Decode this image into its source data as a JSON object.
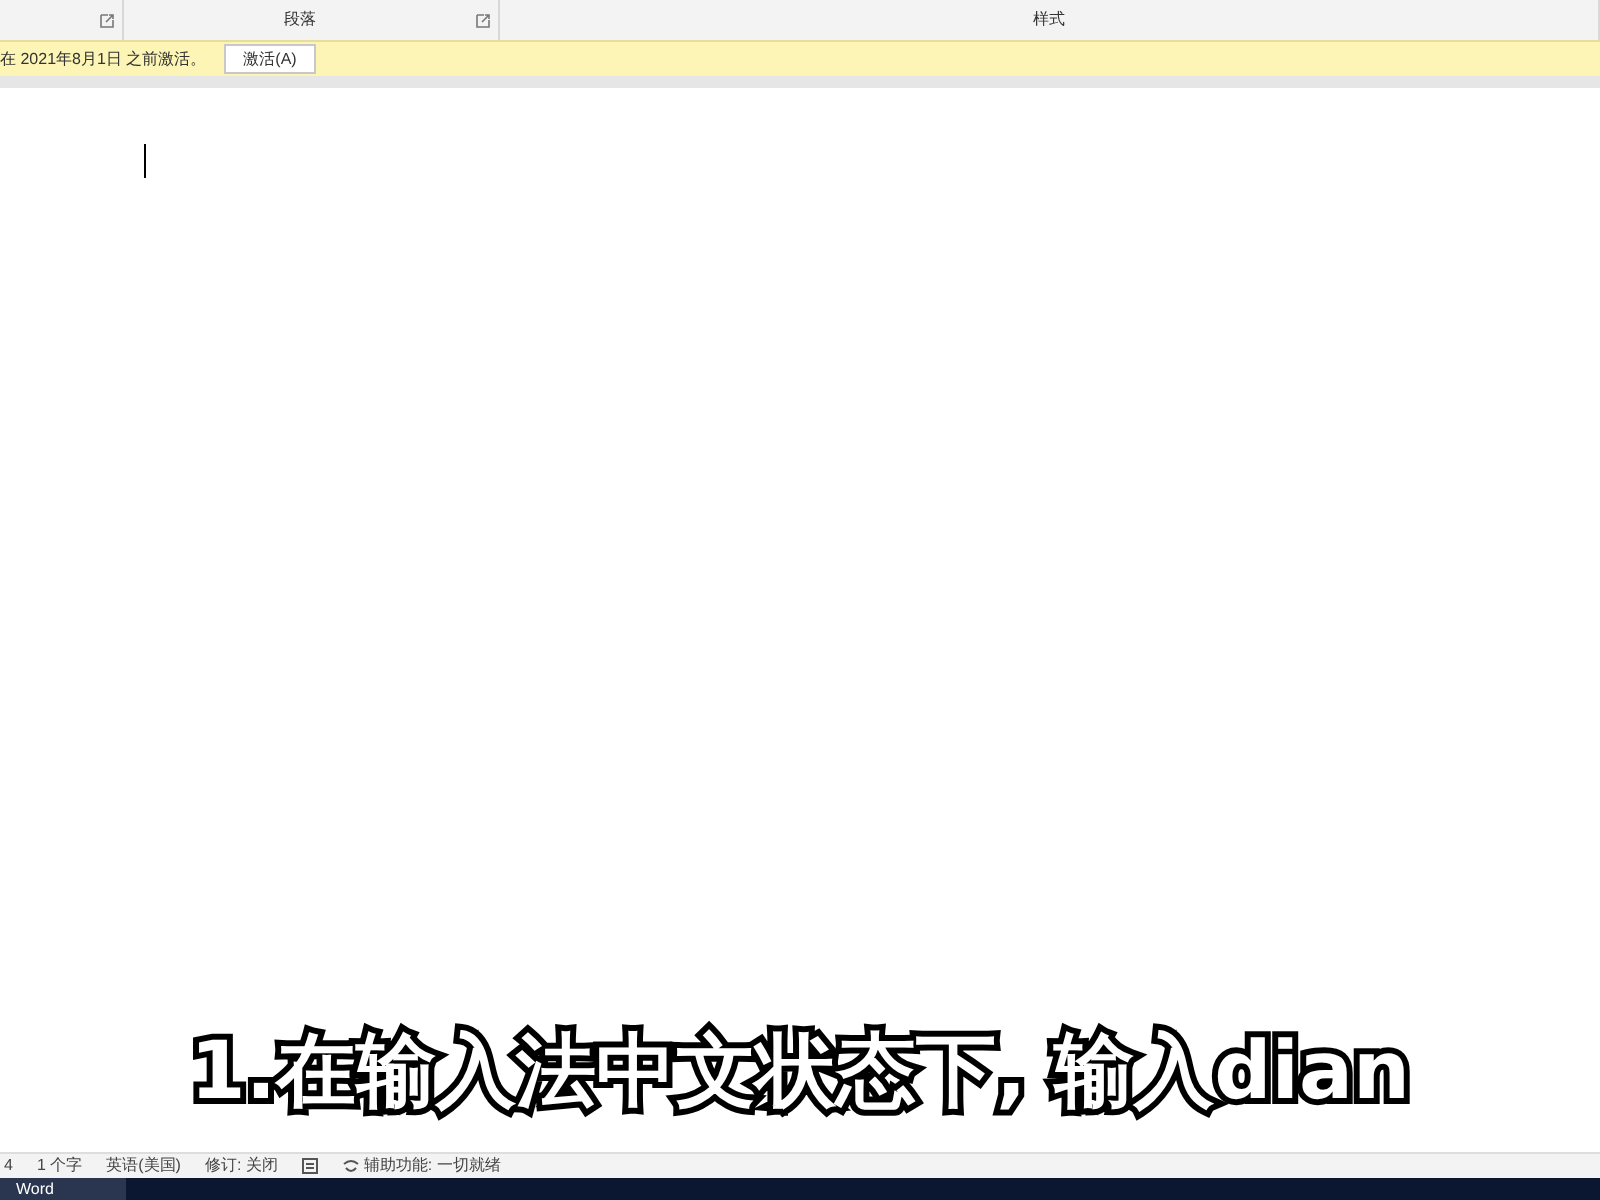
{
  "ribbon": {
    "groups": [
      {
        "launcher": true
      },
      {
        "label": "段落",
        "launcher": true
      },
      {
        "label": "样式",
        "launcher": false
      }
    ]
  },
  "notice": {
    "text": "在 2021年8月1日 之前激活。",
    "button": "激活(A)"
  },
  "caption": "1.在输入法中文状态下, 输入dian",
  "status_bar": {
    "items": [
      "4",
      "1 个字",
      "英语(美国)",
      "修订: 关闭"
    ],
    "accessibility": "辅助功能: 一切就绪"
  },
  "taskbar": {
    "app": "Word"
  }
}
